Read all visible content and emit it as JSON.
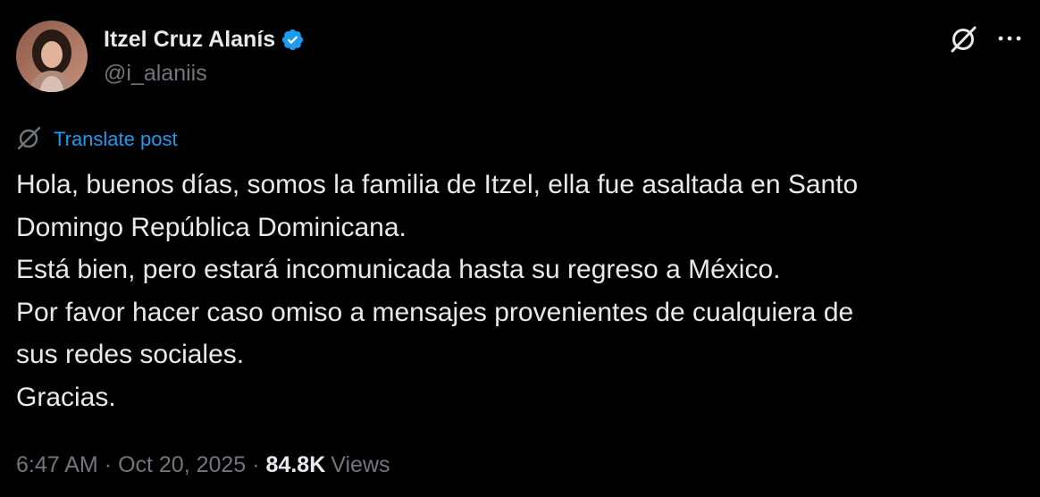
{
  "author": {
    "display_name": "Itzel Cruz Alanís",
    "handle": "@i_alaniis",
    "verified": true,
    "verified_icon": "verified-badge-icon",
    "verified_color": "#1d9bf0"
  },
  "header_actions": {
    "grok_icon": "grok-icon",
    "more_icon": "more-horizontal-icon"
  },
  "translate": {
    "icon": "translate-grok-icon",
    "label": "Translate post",
    "color": "#1d9bf0"
  },
  "post": {
    "lines": [
      "Hola, buenos días, somos la familia de Itzel, ella fue asaltada en Santo",
      "Domingo República Dominicana.",
      "Está bien, pero estará incomunicada hasta su regreso a México.",
      "Por favor hacer caso omiso a mensajes provenientes de cualquiera de",
      "sus redes sociales.",
      "Gracias."
    ]
  },
  "meta": {
    "time": "6:47 AM",
    "separator": "·",
    "date": "Oct 20, 2025",
    "views_count": "84.8K",
    "views_label": "Views"
  },
  "colors": {
    "background": "#000000",
    "primary_text": "#e7e9ea",
    "secondary_text": "#71767b",
    "accent": "#1d9bf0"
  }
}
